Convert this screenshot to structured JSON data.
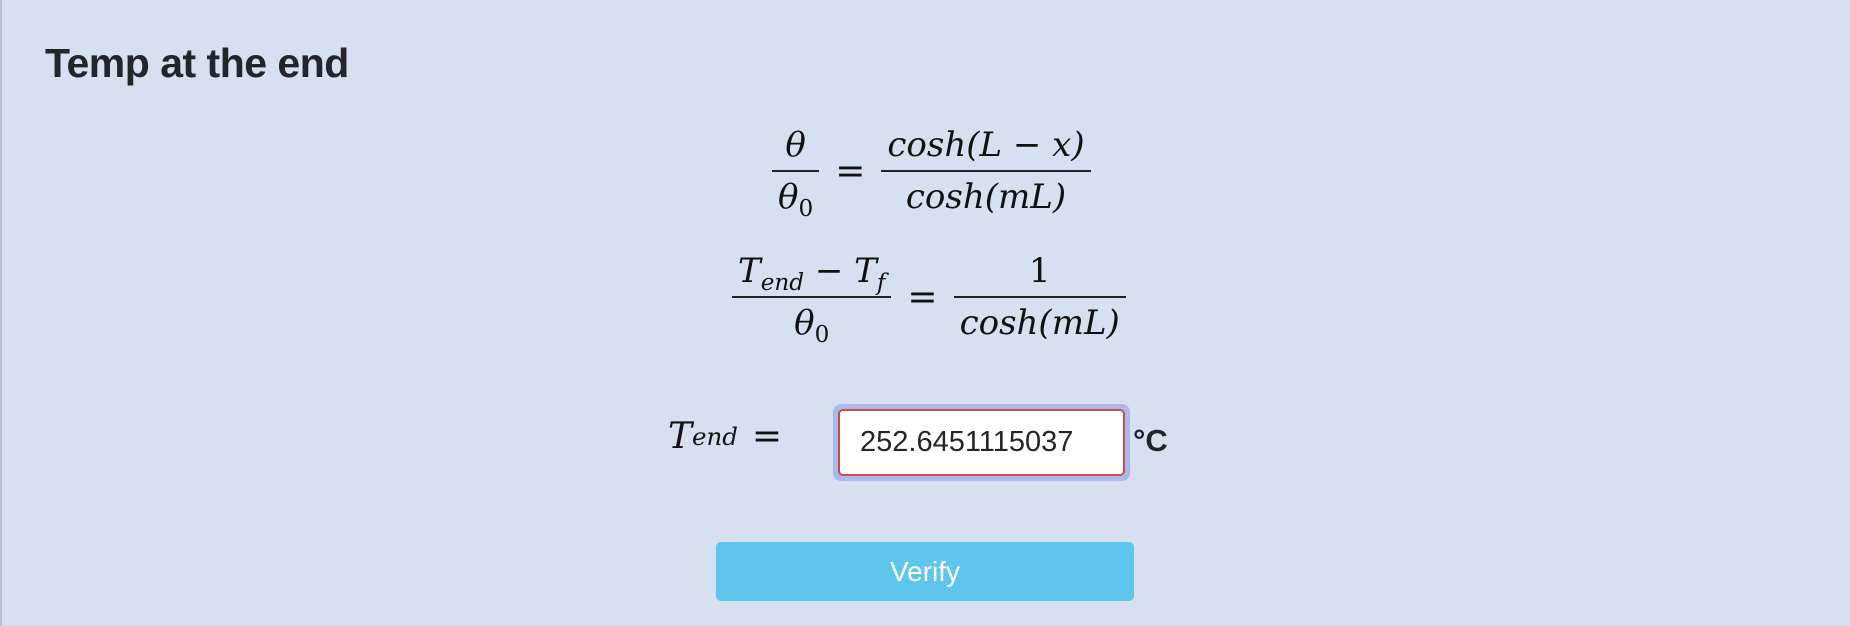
{
  "page": {
    "title": "Temp at the end"
  },
  "equations": {
    "eq1": {
      "lhs_num": "θ",
      "lhs_den_var": "θ",
      "lhs_den_sub": "0",
      "equals": "=",
      "rhs_num": "cosh(L − x)",
      "rhs_den": "cosh(mL)"
    },
    "eq2": {
      "lhs_num_var1": "T",
      "lhs_num_sub1": "end",
      "lhs_num_op": " − ",
      "lhs_num_var2": "T",
      "lhs_num_sub2": "f",
      "lhs_den_var": "θ",
      "lhs_den_sub": "0",
      "equals": "=",
      "rhs_num": "1",
      "rhs_den": "cosh(mL)"
    }
  },
  "answer": {
    "label_var": "T",
    "label_sub": "end",
    "label_equals": "=",
    "value": "252.6451115037",
    "unit": "°C"
  },
  "actions": {
    "verify_label": "Verify"
  },
  "colors": {
    "background": "#d7e0f0",
    "button": "#5ec6ec",
    "input_border_error": "#d24848",
    "input_focus_ring": "#a9b9ec"
  }
}
